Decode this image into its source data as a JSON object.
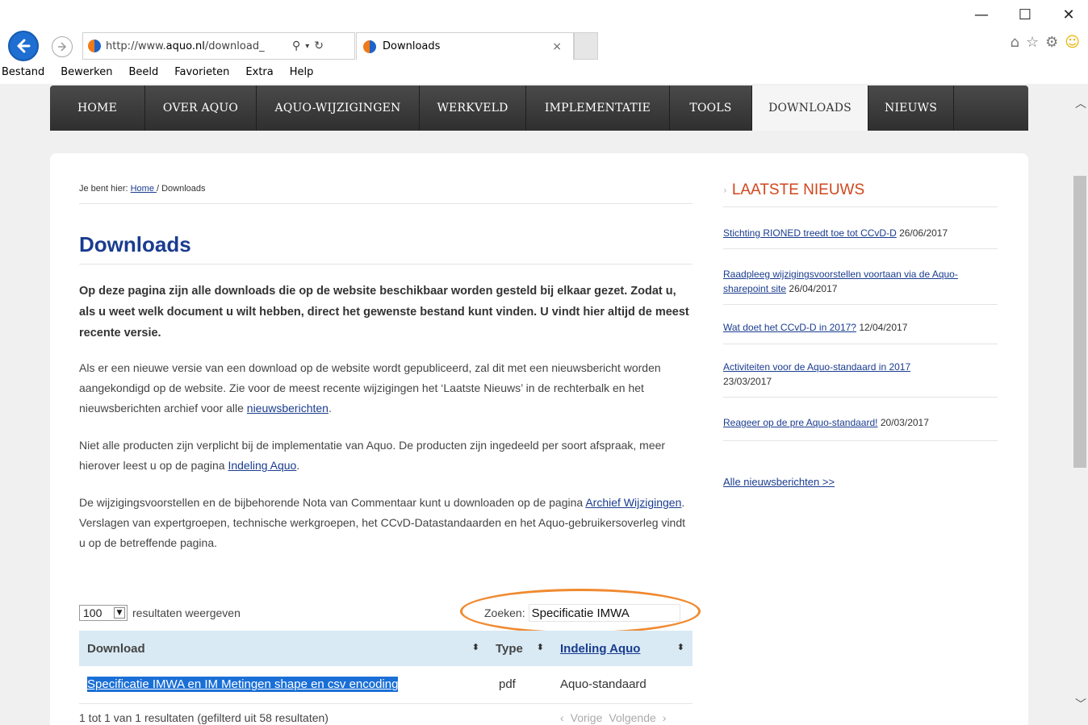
{
  "window": {
    "minimize": "—",
    "maximize": "☐",
    "close": "✕"
  },
  "browser": {
    "url_prefix": "http://www.",
    "url_domain": "aquo.nl",
    "url_rest": "/download_",
    "tab_title": "Downloads",
    "tab_close": "×",
    "menu": [
      "Bestand",
      "Bewerken",
      "Beeld",
      "Favorieten",
      "Extra",
      "Help"
    ]
  },
  "nav": {
    "items": [
      "HOME",
      "OVER AQUO",
      "AQUO-WIJZIGINGEN",
      "WERKVELD",
      "IMPLEMENTATIE",
      "TOOLS",
      "DOWNLOADS",
      "NIEUWS"
    ],
    "active": "DOWNLOADS"
  },
  "breadcrumb": {
    "prefix": "Je bent hier: ",
    "home": "Home ",
    "current": "/ Downloads"
  },
  "page": {
    "title": "Downloads",
    "intro": "Op deze pagina zijn alle downloads die op de website beschikbaar worden gesteld bij elkaar gezet. Zodat u, als u weet welk document u wilt hebben, direct het gewenste bestand kunt vinden. U vindt hier altijd de meest recente versie.",
    "p1_a": "Als er een nieuwe versie van een download op de website wordt gepubliceerd, zal dit met een nieuwsbericht worden aangekondigd op de website. Zie voor de meest recente wijzigingen het ‘Laatste Nieuws’ in de rechterbalk en het nieuwsberichten archief voor alle ",
    "p1_link": "nieuwsberichten",
    "p1_b": ".",
    "p2_a": "Niet alle producten zijn verplicht bij de implementatie van Aquo. De producten zijn ingedeeld per soort afspraak, meer hierover leest u op de pagina ",
    "p2_link": "Indeling Aquo",
    "p2_b": ".",
    "p3_a": "De wijzigingsvoorstellen en de bijbehorende Nota van Commentaar kunt u downloaden op de pagina ",
    "p3_link": "Archief Wijzigingen",
    "p3_b": ". Verslagen van expertgroepen, technische werkgroepen, het CCvD-Datastandaarden en het Aquo-gebruikersoverleg vindt u op de betreffende pagina."
  },
  "table": {
    "length_value": "100",
    "length_label": "resultaten weergeven",
    "search_label": "Zoeken:",
    "search_value": "Specificatie IMWA",
    "columns": [
      "Download",
      "Type",
      "Indeling Aquo"
    ],
    "sort_icon": "⬍",
    "rows": [
      {
        "download": "Specificatie IMWA en IM Metingen shape en csv encoding",
        "type": "pdf",
        "indeling": "Aquo-standaard"
      }
    ],
    "info": "1 tot 1 van 1 resultaten (gefilterd uit 58 resultaten)",
    "prev": "Vorige",
    "next": "Volgende"
  },
  "sidebar": {
    "title": "LAATSTE NIEUWS",
    "news": [
      {
        "title": "Stichting RIONED treedt toe tot CCvD-D",
        "date": "26/06/2017"
      },
      {
        "title": "Raadpleeg wijzigingsvoorstellen voortaan via de Aquo-sharepoint site",
        "date": "26/04/2017"
      },
      {
        "title": "Wat doet het CCvD-D in 2017?",
        "date": "12/04/2017"
      },
      {
        "title": "Activiteiten voor de Aquo-standaard in 2017",
        "date": "23/03/2017"
      },
      {
        "title": "Reageer op de pre Aquo-standaard!",
        "date": "20/03/2017"
      }
    ],
    "all_news": "Alle nieuwsberichten >>"
  }
}
